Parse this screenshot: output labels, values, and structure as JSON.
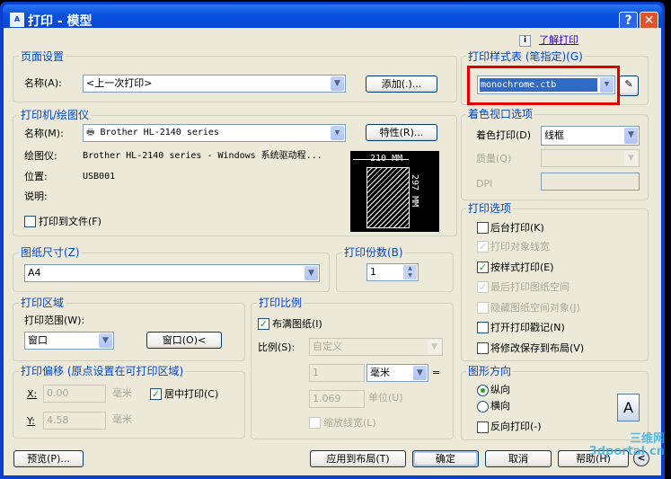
{
  "window": {
    "title": "打印 - 模型",
    "help": "?",
    "close": "✕"
  },
  "learn_link": "了解打印",
  "page_setup": {
    "title": "页面设置",
    "name_label": "名称(A):",
    "name_value": "<上一次打印>",
    "add_button": "添加(.)..."
  },
  "printer": {
    "title": "打印机/绘图仪",
    "name_label": "名称(M):",
    "name_value": "Brother HL-2140 series",
    "properties_button": "特性(R)...",
    "plotter_label": "绘图仪:",
    "plotter_value": "Brother HL-2140 series - Windows 系统驱动程...",
    "location_label": "位置:",
    "location_value": "USB001",
    "description_label": "说明:",
    "print_to_file": "打印到文件(F)",
    "preview_width": "210 MM",
    "preview_height": "297 MM"
  },
  "paper_size": {
    "title": "图纸尺寸(Z)",
    "value": "A4"
  },
  "copies": {
    "title": "打印份数(B)",
    "value": "1"
  },
  "plot_area": {
    "title": "打印区域",
    "range_label": "打印范围(W):",
    "range_value": "窗口",
    "window_button": "窗口(O)<"
  },
  "offset": {
    "title": "打印偏移 (原点设置在可打印区域)",
    "x_label": "X:",
    "x_value": "0.00",
    "y_label": "Y:",
    "y_value": "4.58",
    "unit": "毫米",
    "center_label": "居中打印(C)",
    "center_checked": true
  },
  "scale": {
    "title": "打印比例",
    "fit_label": "布满图纸(I)",
    "fit_checked": true,
    "scale_label": "比例(S):",
    "scale_value": "自定义",
    "value1": "1",
    "unit_value": "毫米",
    "equals": "=",
    "value2": "1.069",
    "unit2_label": "单位(U)",
    "lineweight_label": "缩放线宽(L)"
  },
  "style_table": {
    "title": "打印样式表 (笔指定)(G)",
    "value": "monochrome.ctb",
    "highlight_color": "#e00000"
  },
  "shaded": {
    "title": "着色视口选项",
    "shade_label": "着色打印(D)",
    "shade_value": "线框",
    "quality_label": "质量(Q)",
    "dpi_label": "DPI"
  },
  "options": {
    "title": "打印选项",
    "items": [
      {
        "label": "后台打印(K)",
        "checked": false,
        "disabled": false
      },
      {
        "label": "打印对象线宽",
        "checked": true,
        "disabled": true
      },
      {
        "label": "按样式打印(E)",
        "checked": true,
        "disabled": false
      },
      {
        "label": "最后打印图纸空间",
        "checked": true,
        "disabled": true
      },
      {
        "label": "隐藏图纸空间对象(J)",
        "checked": false,
        "disabled": true
      },
      {
        "label": "打开打印戳记(N)",
        "checked": false,
        "disabled": false
      },
      {
        "label": "将修改保存到布局(V)",
        "checked": false,
        "disabled": false
      }
    ]
  },
  "orientation": {
    "title": "图形方向",
    "portrait": "纵向",
    "landscape": "横向",
    "reverse": "反向打印(-)",
    "icon_letter": "A"
  },
  "buttons": {
    "preview": "预览(P)...",
    "apply": "应用到布局(T)",
    "ok": "确定",
    "cancel": "取消",
    "help": "帮助(H)"
  },
  "watermark": "三维网 3dportal.cn"
}
